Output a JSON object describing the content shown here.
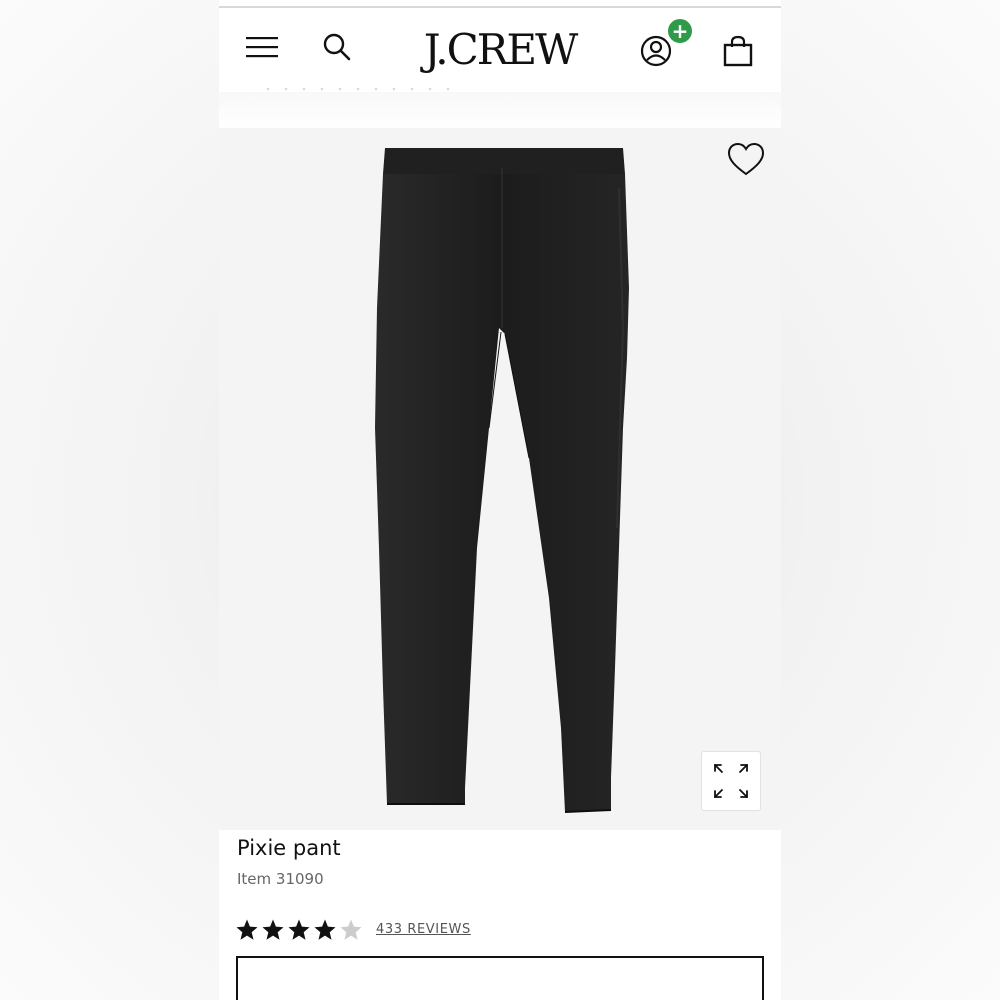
{
  "header": {
    "logo_text": "J.CREW",
    "icons": {
      "menu": "hamburger-menu-icon",
      "search": "search-icon",
      "account": "account-icon",
      "bag": "shopping-bag-icon"
    },
    "account_badge": "+",
    "badge_color": "#2f9a4a"
  },
  "product": {
    "name": "Pixie pant",
    "item_label": "Item 31090",
    "rating": 4,
    "rating_max": 5,
    "reviews_label": "433 REVIEWS",
    "image_icon": "black-pants-image",
    "wishlist_icon": "heart-icon",
    "expand_icon": "expand-icon"
  },
  "colors": {
    "star_filled": "#111111",
    "star_empty": "#cccccc",
    "image_bg": "#f4f4f4",
    "product_color": "#1f1f1f"
  }
}
